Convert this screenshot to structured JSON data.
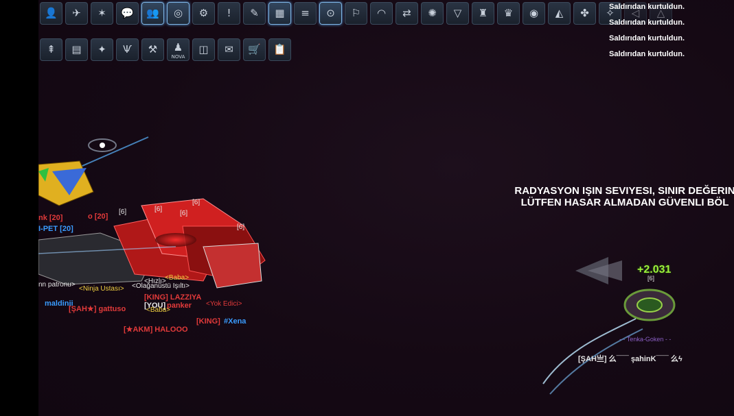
{
  "toolbar": {
    "row1": [
      {
        "icon": "user-icon",
        "glyph": "👤",
        "active": false
      },
      {
        "icon": "ship-equipment-icon",
        "glyph": "✈",
        "active": false
      },
      {
        "icon": "skills-icon",
        "glyph": "✶",
        "active": false
      },
      {
        "icon": "chat-icon",
        "glyph": "💬",
        "active": false
      },
      {
        "icon": "group-icon",
        "glyph": "👥",
        "active": true
      },
      {
        "icon": "target-icon",
        "glyph": "◎",
        "active": true
      },
      {
        "icon": "pet-icon",
        "glyph": "⚙",
        "active": false
      },
      {
        "icon": "alert-icon",
        "glyph": "!",
        "active": false
      },
      {
        "icon": "missions-icon",
        "glyph": "✎",
        "active": false
      },
      {
        "icon": "map-icon",
        "glyph": "▦",
        "active": true
      },
      {
        "icon": "log-icon",
        "glyph": "≡",
        "active": false
      },
      {
        "icon": "location-icon",
        "glyph": "⊙",
        "active": true
      },
      {
        "icon": "clan-icon",
        "glyph": "⚐",
        "active": false
      },
      {
        "icon": "gauge-icon",
        "glyph": "◠",
        "active": false
      },
      {
        "icon": "trade-icon",
        "glyph": "⇄",
        "active": false
      },
      {
        "icon": "galaxy-gate-icon",
        "glyph": "✺",
        "active": false
      },
      {
        "icon": "shield-icon",
        "glyph": "▽",
        "active": false
      },
      {
        "icon": "trophy-icon",
        "glyph": "♜",
        "active": false
      },
      {
        "icon": "eagle-icon",
        "glyph": "♛",
        "active": false
      },
      {
        "icon": "wings-icon",
        "glyph": "◉",
        "active": false
      },
      {
        "icon": "sail-icon",
        "glyph": "◭",
        "active": false
      },
      {
        "icon": "drone-icon",
        "glyph": "✤",
        "active": false
      },
      {
        "icon": "rank-icon",
        "glyph": "✧",
        "active": false
      },
      {
        "icon": "speaker-icon",
        "glyph": "◁",
        "active": false,
        "faded": true
      },
      {
        "icon": "triangle-icon",
        "glyph": "△",
        "active": false,
        "faded": true
      }
    ],
    "row2": [
      {
        "icon": "upgrade-icon",
        "glyph": "⇞",
        "active": false
      },
      {
        "icon": "id-card-icon",
        "glyph": "▤",
        "active": false
      },
      {
        "icon": "satellite-icon",
        "glyph": "✦",
        "active": false
      },
      {
        "icon": "faction-icon",
        "glyph": "Ѱ",
        "active": false
      },
      {
        "icon": "auction-icon",
        "glyph": "⚒",
        "active": false
      },
      {
        "icon": "nova-icon",
        "glyph": "♟",
        "label": "NOVA",
        "active": false
      },
      {
        "icon": "monitor-icon",
        "glyph": "◫",
        "active": false
      },
      {
        "icon": "mail-icon",
        "glyph": "✉",
        "active": false
      },
      {
        "icon": "shop-cart-icon",
        "glyph": "🛒",
        "active": false
      },
      {
        "icon": "clipboard-icon",
        "glyph": "📋",
        "active": false
      }
    ]
  },
  "log": {
    "lines": [
      "Saldırıdan kurtuldun.",
      "Saldırıdan kurtuldun.",
      "Saldırıdan kurtuldun.",
      "Saldırıdan kurtuldun."
    ]
  },
  "warning": {
    "line1": "RADYASYON IŞIN SEVIYESI, SINIR DEĞERIN",
    "line2": "LÜTFEN HASAR ALMADAN GÜVENLI BÖL"
  },
  "scene": {
    "heal_value": "+2.031",
    "player_name": "[ŞAH亗] 么¯¯¯ şahinK¯¯¯ 么ϟ",
    "player_subtitle": "- - Tenka-Goken - -",
    "player_level_tag": "[6]",
    "left_labels": [
      {
        "text": "[6]",
        "cls": "wht"
      },
      {
        "text": "[6]",
        "cls": "wht"
      },
      {
        "text": "[6]",
        "cls": "wht"
      },
      {
        "text": "[6]",
        "cls": "wht"
      },
      {
        "text": "[6]",
        "cls": "wht"
      },
      {
        "text": "nk [20]",
        "cls": "red nm"
      },
      {
        "text": "o [20]",
        "cls": "red nm"
      },
      {
        "text": "I-PET [20]",
        "cls": "blue nm"
      },
      {
        "text": "<Hızlı>",
        "cls": "wht"
      },
      {
        "text": "<Baba>",
        "cls": "yel"
      },
      {
        "text": "nn patronu>",
        "cls": "wht"
      },
      {
        "text": "<Ninja Ustası>",
        "cls": "yel"
      },
      {
        "text": "<Olağanüstü Işıltı>",
        "cls": "wht"
      },
      {
        "text": "[KING] LAZZIYA",
        "cls": "red nm"
      },
      {
        "text": "maldinii",
        "cls": "blue nm"
      },
      {
        "text": "[ŞAH★] gattuso",
        "cls": "red nm"
      },
      {
        "text": "[YOU]",
        "cls": "wht nm"
      },
      {
        "text": "panker",
        "cls": "red nm"
      },
      {
        "text": "<Yok Edici>",
        "cls": "red"
      },
      {
        "text": "<Baba>",
        "cls": "yel"
      },
      {
        "text": "[KING]",
        "cls": "red nm"
      },
      {
        "text": "#Xena",
        "cls": "blue nm"
      },
      {
        "text": "[★AKM] HALOOO",
        "cls": "red nm"
      }
    ]
  }
}
